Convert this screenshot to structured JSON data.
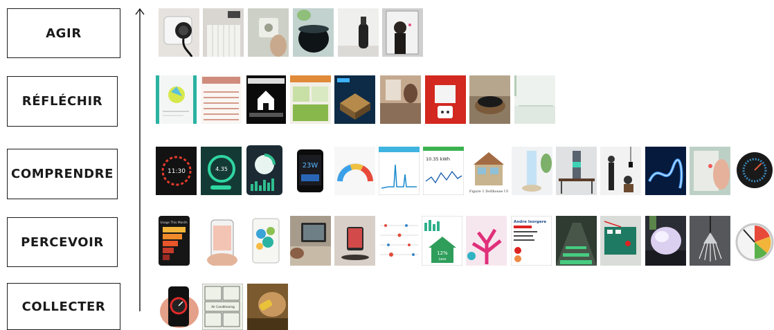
{
  "stages": [
    {
      "label": "AGIR"
    },
    {
      "label": "RÉFLÉCHIR"
    },
    {
      "label": "COMPRENDRE"
    },
    {
      "label": "PERCEVOIR"
    },
    {
      "label": "COLLECTER"
    }
  ],
  "tile_text": {
    "clock_time": "11:30",
    "energy_value": "4.35",
    "big_power": "23W",
    "kwh_reading": "10.35 kWh",
    "usage_title": "Usage This Month",
    "percent_less": "12%",
    "less_word": "Less",
    "person_name": "Andre Isorgere",
    "figure_caption": "Figure 1 Dollhouse UI",
    "air_conditioning": "Air Conditioning"
  },
  "colors": {
    "accent_red": "#e02a2a",
    "accent_green": "#2f9e5b",
    "dark": "#111111",
    "neon_blue": "#1e7bff"
  }
}
